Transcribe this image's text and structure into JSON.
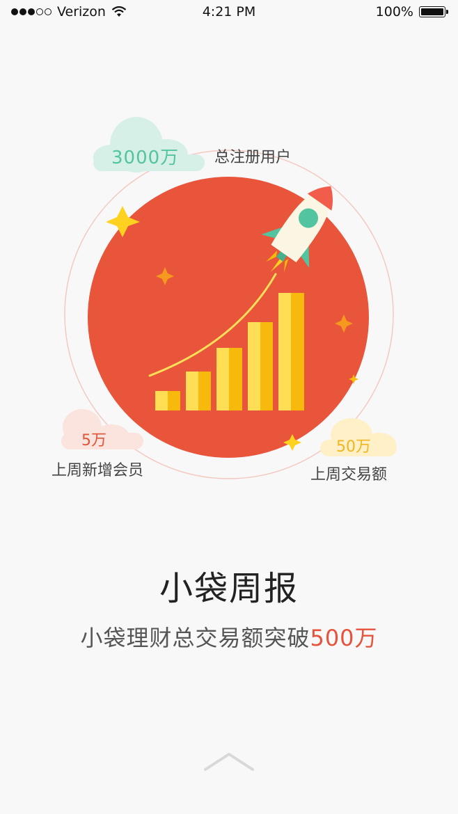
{
  "status_bar": {
    "carrier": "Verizon",
    "time": "4:21 PM",
    "battery": "100%",
    "signal_full": 3,
    "signal_total": 5
  },
  "stats": {
    "total_users_value": "3000万",
    "total_users_label": "总注册用户",
    "new_members_value": "5万",
    "new_members_label": "上周新增会员",
    "trade_value": "50万",
    "trade_label": "上周交易额"
  },
  "main": {
    "title": "小袋周报",
    "subtitle_prefix": "小袋理财总交易额突破",
    "subtitle_highlight": "500万"
  },
  "colors": {
    "circle": "#e8553a",
    "bar_light": "#ffdd55",
    "bar_dark": "#f7b90c",
    "cloud_green": "#d6f0e8",
    "cloud_pink": "#fbe3de",
    "cloud_yellow": "#fff0c8",
    "accent_green": "#52c5a0",
    "accent_red": "#e6533a",
    "accent_yellow": "#f2b51f"
  },
  "icons": [
    "wifi-icon",
    "battery-icon",
    "rocket-icon",
    "star-icon",
    "chevron-up-icon"
  ]
}
